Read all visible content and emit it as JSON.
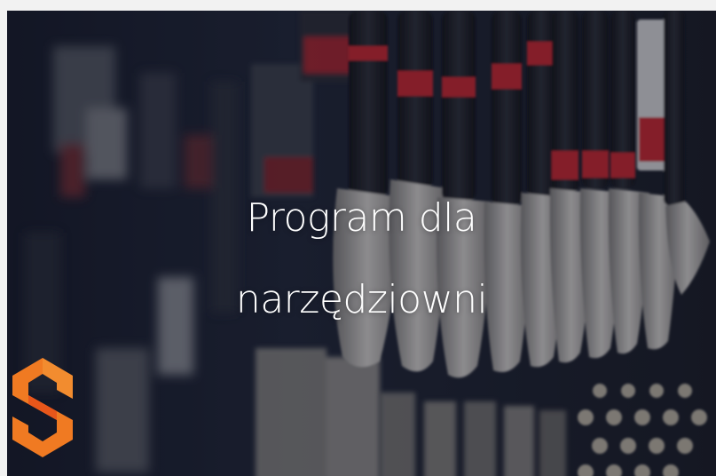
{
  "hero": {
    "title_line1": "Program dla",
    "title_line2": "narzędziowni",
    "background_image": "blurred-wrenches-on-pegboard",
    "overlay_color": "#141828"
  },
  "logo": {
    "icon": "brand-s-hexagon-logo",
    "primary_color": "#f07a22",
    "secondary_color": "#e8561a"
  },
  "colors": {
    "wrench_handle": "#1a1c22",
    "wrench_red_band": "#c8202a",
    "wrench_metal": "#b8b6b2"
  }
}
